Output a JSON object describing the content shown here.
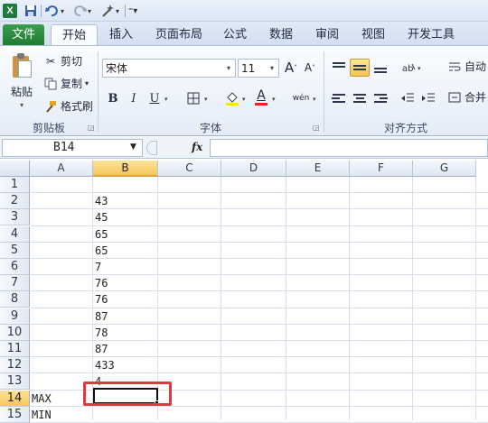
{
  "qat": {
    "app_icon": "X",
    "save_icon": "save-icon",
    "undo_icon": "undo-icon",
    "redo_icon": "redo-icon",
    "customize_icon": "wand-icon"
  },
  "tabs": [
    {
      "label": "文件"
    },
    {
      "label": "开始"
    },
    {
      "label": "插入"
    },
    {
      "label": "页面布局"
    },
    {
      "label": "公式"
    },
    {
      "label": "数据"
    },
    {
      "label": "审阅"
    },
    {
      "label": "视图"
    },
    {
      "label": "开发工具"
    }
  ],
  "ribbon": {
    "clipboard": {
      "paste": "粘贴",
      "cut": "剪切",
      "copy": "复制",
      "format_painter": "格式刷",
      "group": "剪贴板"
    },
    "font": {
      "font_name": "宋体",
      "font_size": "11",
      "grow": "A",
      "shrink": "A",
      "bold": "B",
      "italic": "I",
      "underline": "U",
      "font_color": "A",
      "phonetic": "wén",
      "group": "字体"
    },
    "alignment": {
      "wrap": "自动",
      "merge": "合并",
      "group": "对齐方式"
    }
  },
  "formula_bar": {
    "name_box": "B14",
    "fx": "fx",
    "formula": ""
  },
  "grid": {
    "columns": [
      "A",
      "B",
      "C",
      "D",
      "E",
      "F",
      "G"
    ],
    "selected_column": "B",
    "rows": [
      "1",
      "2",
      "3",
      "4",
      "5",
      "6",
      "7",
      "8",
      "9",
      "10",
      "11",
      "12",
      "13",
      "14",
      "15"
    ],
    "selected_row": "14",
    "cells": {
      "B2": "43",
      "B3": "45",
      "B4": "65",
      "B5": "65",
      "B6": "7",
      "B7": "76",
      "B8": "76",
      "B9": "87",
      "B10": "78",
      "B11": "87",
      "B12": "433",
      "B13": "4",
      "A14": "MAX",
      "A15": "MIN"
    }
  },
  "colors": {
    "file_tab": "#1d7a33",
    "selection_header": "#f5c65a",
    "highlight": "#e0383e"
  }
}
